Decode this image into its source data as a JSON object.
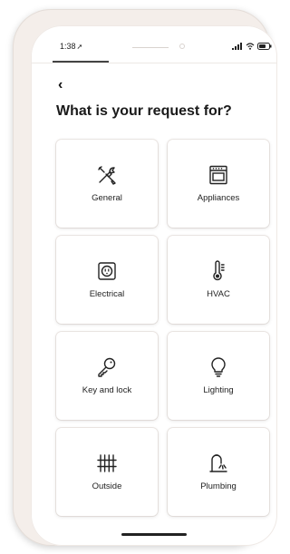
{
  "status_bar": {
    "time": "1:38",
    "location_icon": "location-arrow-icon",
    "indicators": [
      "signal-icon",
      "wifi-icon",
      "battery-icon"
    ]
  },
  "nav": {
    "back_label": "‹",
    "back_icon": "chevron-left-icon"
  },
  "title": "What is your request for?",
  "categories": [
    {
      "label": "General",
      "icon": "tools-icon"
    },
    {
      "label": "Appliances",
      "icon": "oven-icon"
    },
    {
      "label": "Electrical",
      "icon": "outlet-icon"
    },
    {
      "label": "HVAC",
      "icon": "thermometer-icon"
    },
    {
      "label": "Key and lock",
      "icon": "key-icon"
    },
    {
      "label": "Lighting",
      "icon": "lightbulb-icon"
    },
    {
      "label": "Outside",
      "icon": "fence-icon"
    },
    {
      "label": "Plumbing",
      "icon": "faucet-icon"
    }
  ]
}
